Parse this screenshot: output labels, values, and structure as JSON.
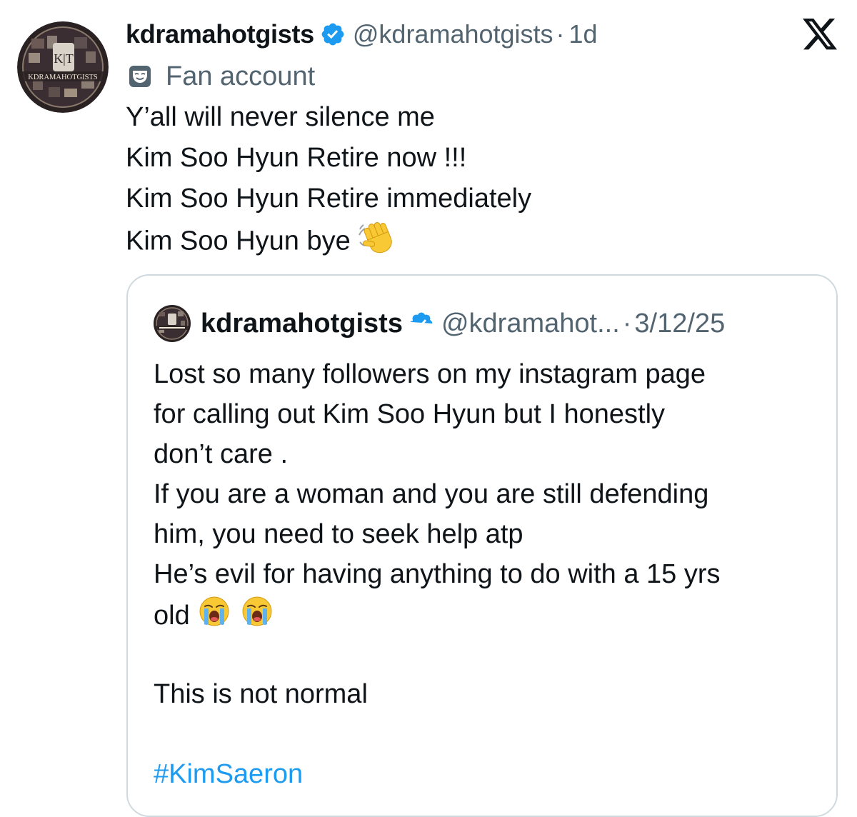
{
  "tweet": {
    "author": {
      "display_name": "kdramahotgists",
      "handle": "@kdramahotgists",
      "avatar_text": "KDRAMAHOTGISTS",
      "avatar_monogram": "K|T",
      "verified_icon": "verified-badge-icon"
    },
    "separator": "·",
    "time": "1d",
    "account_label": {
      "icon": "theater-masks-icon",
      "text": "Fan account"
    },
    "text_lines": [
      "Y’all will never silence me",
      "Kim Soo Hyun Retire now !!!",
      "Kim Soo Hyun Retire immediately",
      "Kim Soo Hyun bye"
    ],
    "trailing_emoji": "waving-hand-emoji"
  },
  "platform": {
    "logo": "x-logo-icon"
  },
  "quoted_tweet": {
    "author": {
      "display_name": "kdramahotgists",
      "handle": "@kdramahot...",
      "verified_icon": "verified-badge-icon"
    },
    "separator": "·",
    "time": "3/12/25",
    "text_lines": [
      "Lost so many followers on my instagram page",
      "for calling out Kim Soo Hyun but I honestly",
      "don’t care .",
      "If you are a woman and you are still defending",
      "him, you need to seek help atp",
      "He’s evil for having anything to do with a 15 yrs",
      "old"
    ],
    "emojis": [
      "loudly-crying-face-emoji",
      "loudly-crying-face-emoji"
    ],
    "closing_line": "This is not normal",
    "hashtag": "#KimSaeron"
  },
  "colors": {
    "text": "#0f1419",
    "secondary": "#536471",
    "accent": "#1d9bf0",
    "border": "#cfd9de"
  }
}
